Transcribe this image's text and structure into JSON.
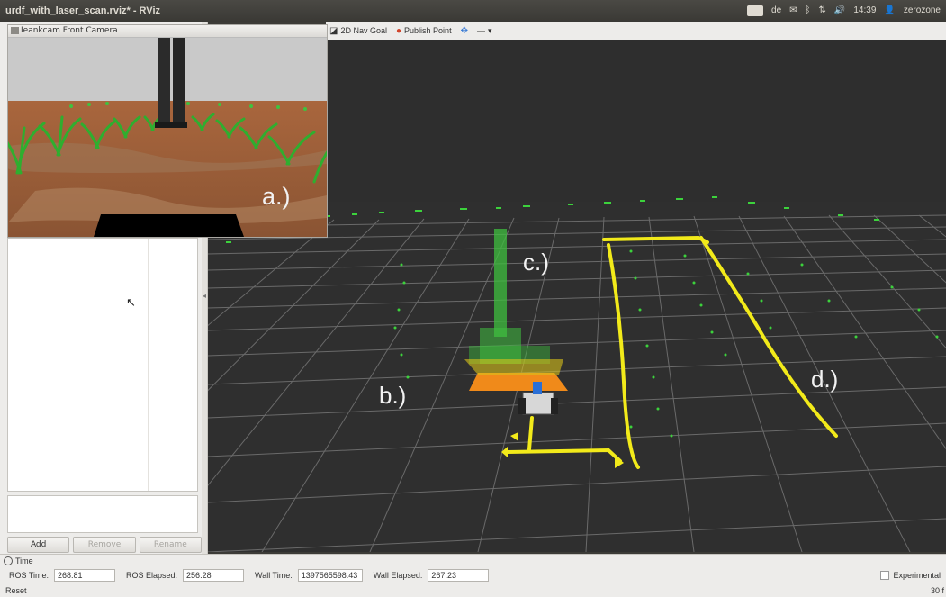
{
  "window": {
    "title": "urdf_with_laser_scan.rviz* - RViz",
    "tray": {
      "keyboard_badge": "EN",
      "lang": "de",
      "time": "14:39",
      "user": "zerozone"
    }
  },
  "toolbar": {
    "nav_goal_label": "2D Nav Goal",
    "publish_point_label": "Publish Point",
    "more_label": "—"
  },
  "camera_panel": {
    "title": "Ieankcam Front Camera",
    "overlay_label": "a.)"
  },
  "viewport": {
    "labels": {
      "b": "b.)",
      "c": "c.)",
      "d": "d.)"
    }
  },
  "displays_panel": {
    "add_label": "Add",
    "remove_label": "Remove",
    "rename_label": "Rename"
  },
  "time_panel": {
    "header": "Time",
    "ros_time_label": "ROS Time:",
    "ros_time_value": "268.81",
    "ros_elapsed_label": "ROS Elapsed:",
    "ros_elapsed_value": "256.28",
    "wall_time_label": "Wall Time:",
    "wall_time_value": "1397565598.43",
    "wall_elapsed_label": "Wall Elapsed:",
    "wall_elapsed_value": "267.23",
    "experimental_label": "Experimental",
    "reset_label": "Reset",
    "fps_label": "30 f"
  },
  "colors": {
    "laser_points": "#3cd23c",
    "path": "#f2ea1a",
    "pointcloud_near": "#f08a1a",
    "grid": "#6a6a6a"
  }
}
